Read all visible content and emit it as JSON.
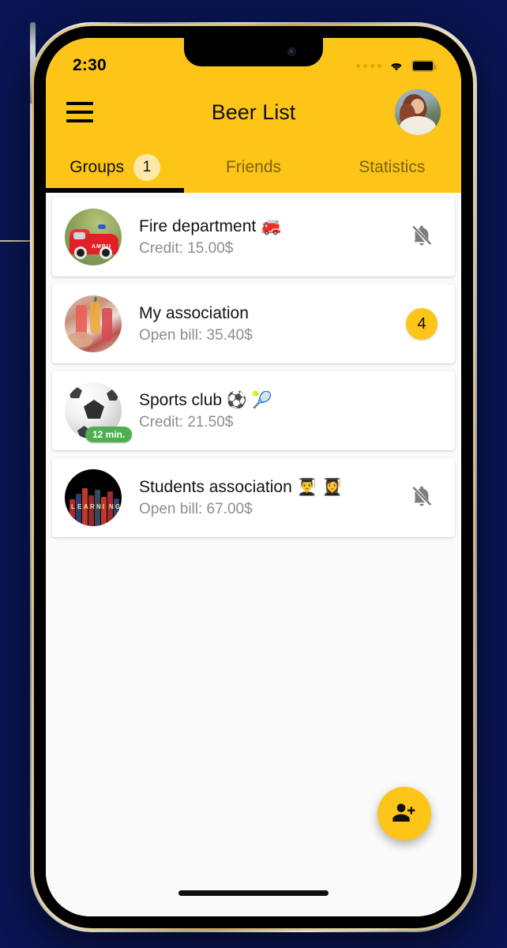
{
  "status_bar": {
    "time": "2:30",
    "signal_icon": "signal-dots-icon",
    "wifi_icon": "wifi-icon",
    "battery_icon": "battery-icon"
  },
  "app_bar": {
    "menu_icon": "hamburger-menu-icon",
    "title": "Beer List",
    "avatar_icon": "user-avatar"
  },
  "tabs": [
    {
      "label": "Groups",
      "badge": "1",
      "active": true
    },
    {
      "label": "Friends",
      "badge": null,
      "active": false
    },
    {
      "label": "Statistics",
      "badge": null,
      "active": false
    }
  ],
  "groups": [
    {
      "title": "Fire department 🚒",
      "subtitle": "Credit: 15.00$",
      "avatar": "fire-truck-photo",
      "right_icon": "bell-off-icon",
      "badge": null,
      "time_badge": null
    },
    {
      "title": "My association",
      "subtitle": "Open bill: 35.40$",
      "avatar": "cocktails-photo",
      "right_icon": null,
      "badge": "4",
      "time_badge": null
    },
    {
      "title": "Sports club ⚽ 🎾",
      "subtitle": "Credit: 21.50$",
      "avatar": "soccer-ball-photo",
      "right_icon": null,
      "badge": null,
      "time_badge": "12 min."
    },
    {
      "title": "Students association 👨‍🎓 👩‍🎓",
      "subtitle": "Open bill: 67.00$",
      "avatar": "books-photo",
      "right_icon": "bell-off-icon",
      "badge": null,
      "time_badge": null
    }
  ],
  "fab": {
    "icon": "person-add-icon"
  },
  "books_letters": [
    "L",
    "E",
    "A",
    "R",
    "N",
    "I",
    "N",
    "G"
  ],
  "colors": {
    "brand_yellow": "#FDC517",
    "badge_light_yellow": "#FCE9A8",
    "green_pill": "#4CAF50",
    "background_navy": "#0a1450",
    "screen_bg": "#fafafa",
    "text_primary": "#141414",
    "text_secondary": "#8d8d8d"
  }
}
